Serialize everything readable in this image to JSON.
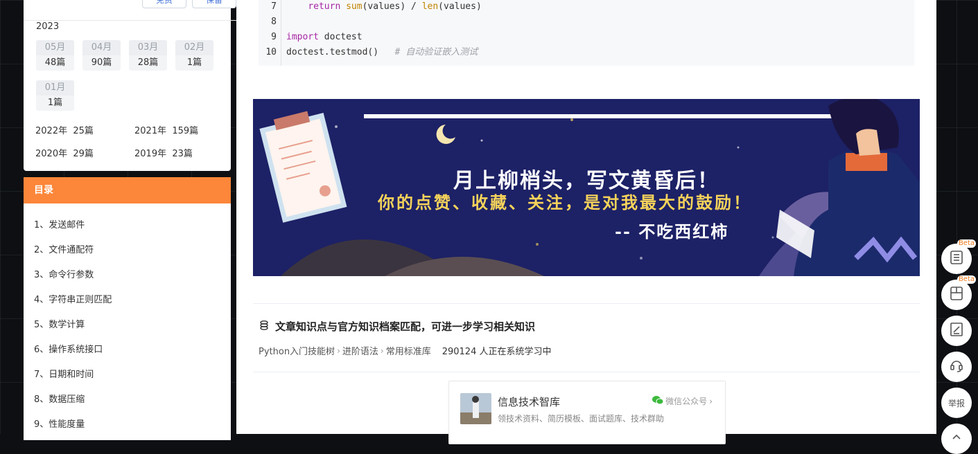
{
  "archive": {
    "top_buttons": [
      "免费",
      "保留"
    ],
    "year": "2023",
    "months": [
      {
        "month": "05月",
        "count": "48篇"
      },
      {
        "month": "04月",
        "count": "90篇"
      },
      {
        "month": "03月",
        "count": "28篇"
      },
      {
        "month": "02月",
        "count": "1篇"
      },
      {
        "month": "01月",
        "count": "1篇"
      }
    ],
    "years": [
      {
        "year": "2022年",
        "count": "25篇"
      },
      {
        "year": "2021年",
        "count": "159篇"
      },
      {
        "year": "2020年",
        "count": "29篇"
      },
      {
        "year": "2019年",
        "count": "23篇"
      }
    ]
  },
  "toc": {
    "title": "目录",
    "items": [
      "1、发送邮件",
      "2、文件通配符",
      "3、命令行参数",
      "4、字符串正则匹配",
      "5、数学计算",
      "6、操作系统接口",
      "7、日期和时间",
      "8、数据压缩",
      "9、性能度量"
    ]
  },
  "code": {
    "lines": [
      {
        "no": "7",
        "text": "    return sum(values) / len(values)"
      },
      {
        "no": "8",
        "text": ""
      },
      {
        "no": "9",
        "text": "import doctest"
      },
      {
        "no": "10",
        "text": "doctest.testmod()   # 自动验证嵌入测试"
      }
    ]
  },
  "banner": {
    "line1": "月上柳梢头，写文黄昏后！",
    "line2": "你的点赞、收藏、关注，是对我最大的鼓励！",
    "line3": "-- 不吃西红柿"
  },
  "skill": {
    "title": "文章知识点与官方知识档案匹配，可进一步学习相关知识",
    "path": [
      "Python入门技能树",
      "进阶语法",
      "常用标准库"
    ],
    "learners": "290124 人正在系统学习中"
  },
  "wechat_card": {
    "name": "信息技术智库",
    "desc": "领技术资料、简历模板、面试题库、技术群助",
    "tag": "微信公众号"
  },
  "toolbar": {
    "beta_label": "Beta",
    "report_label": "举报"
  },
  "colors": {
    "accent": "#fc8639",
    "banner_bg": "#1d2166",
    "banner_yellow": "#f6d35a"
  }
}
